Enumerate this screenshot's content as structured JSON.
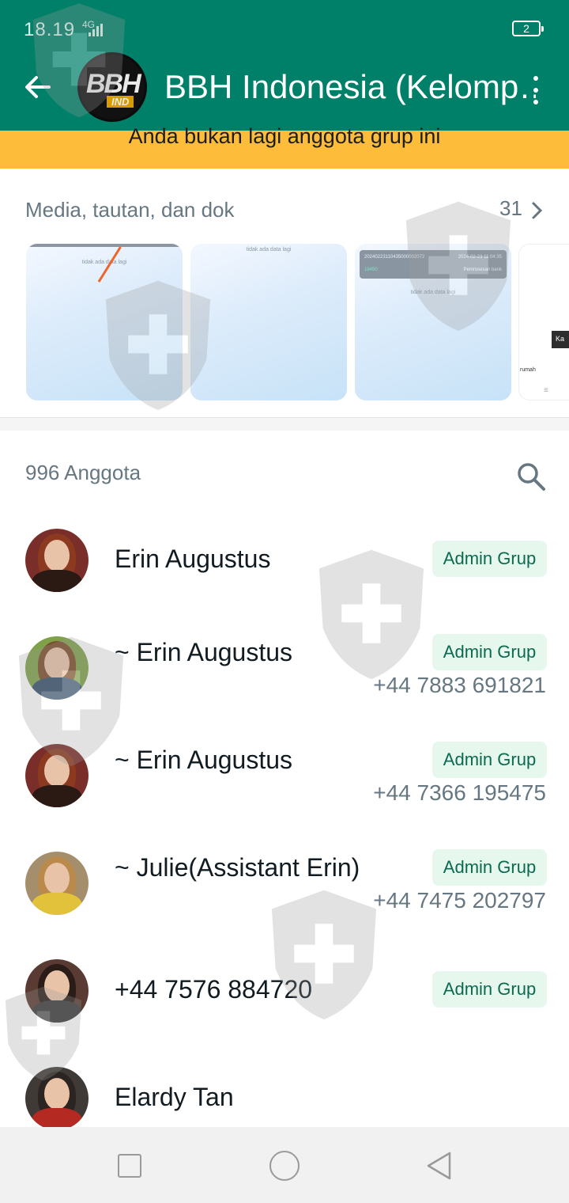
{
  "status_bar": {
    "time": "18.19",
    "network": "4G",
    "battery": "2"
  },
  "header": {
    "title": "BBH Indonesia (Kelomp…",
    "logo_main": "BBH",
    "logo_sub": "IND"
  },
  "banner": {
    "text": "Anda bukan lagi anggota grup ini"
  },
  "media": {
    "heading": "Media, tautan, dan dok",
    "count": "31",
    "thumbnails": [
      {
        "caption": "tidak ada data lagi"
      },
      {
        "caption": "tidak ada data lagi"
      },
      {
        "caption": "tidak ada data lagi",
        "panel_left": "20240223110435000002072",
        "panel_right": "2024-02-23 11:04:35",
        "panel_value": "18450",
        "panel_note": "Pemrosesan bank"
      },
      {
        "tag": "Ka",
        "home": "rumah",
        "lines": "≡"
      }
    ]
  },
  "members": {
    "heading": "996 Anggota",
    "badge_label": "Admin Grup",
    "list": [
      {
        "name": "Erin Augustus",
        "phone": "",
        "admin": "Admin Grup"
      },
      {
        "name": "~ Erin Augustus",
        "phone": "+44 7883 691821",
        "admin": "Admin Grup"
      },
      {
        "name": "~ Erin Augustus",
        "phone": "+44 7366 195475",
        "admin": "Admin Grup"
      },
      {
        "name": "~ Julie(Assistant Erin)",
        "phone": "+44 7475 202797",
        "admin": "Admin Grup"
      },
      {
        "name": "+44 7576 884720",
        "phone": "",
        "admin": "Admin Grup"
      },
      {
        "name": "Elardy Tan",
        "phone": "",
        "admin": ""
      }
    ]
  },
  "colors": {
    "header_bg": "#008069",
    "banner_bg": "#fdbc3a",
    "badge_bg": "#e6f7ee",
    "badge_text": "#0b6a4f",
    "muted_text": "#667781"
  },
  "icons": [
    "back-arrow-icon",
    "menu-dots-icon",
    "chevron-right-icon",
    "search-icon",
    "nav-recents-icon",
    "nav-home-icon",
    "nav-back-icon",
    "signal-icon",
    "battery-icon",
    "shield-watermark-icon"
  ]
}
